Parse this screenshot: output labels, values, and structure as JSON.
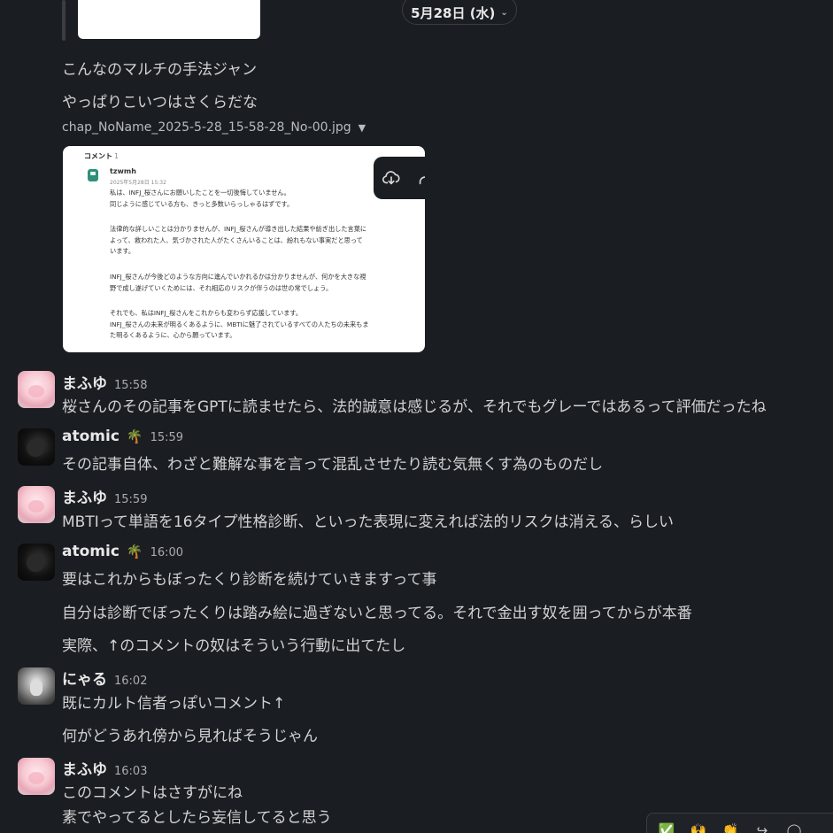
{
  "date_divider": {
    "label": "5月28日 (水)",
    "chevron": "⌄"
  },
  "top_lines": [
    "こんなのマルチの手法ジャン",
    "やっぱりこいつはさくらだな"
  ],
  "attachment": {
    "file_name": "chap_NoName_2025-5-28_15-58-28_No-00.jpg",
    "comment_header": "コメント",
    "comment_count": "1",
    "comment_user": "tzwmh",
    "comment_date": "2025年5月28日 15:32",
    "paragraphs": [
      [
        "私は、INFJ_桜さんにお願いしたことを一切後悔していません。",
        "同じように感じている方も、きっと多数いらっしゃるはずです。"
      ],
      [
        "法律的な詳しいことは分かりませんが、INFJ_桜さんが導き出した結果や紡ぎ出した言葉に",
        "よって、救われた人、気づかされた人がたくさんいることは、紛れもない事実だと思って",
        "います。"
      ],
      [
        "INFJ_桜さんが今後どのような方向に進んでいかれるかは分かりませんが、何かを大きな視",
        "野で成し遂げていくためには、それ相応のリスクが伴うのは世の常でしょう。"
      ],
      [
        "それでも、私はINFJ_桜さんをこれからも変わらず応援しています。",
        "INFJ_桜さんの未来が明るくあるように、MBTIに魅了されているすべての人たちの未来もま",
        "た明るくあるように、心から願っています。"
      ]
    ],
    "toolbar_icons": [
      "download-icon",
      "share-icon",
      "more-vertical-icon"
    ]
  },
  "messages": [
    {
      "name": "まふゆ",
      "emoji": "",
      "time": "15:58",
      "avatar": "mafuyu",
      "lines": [
        "桜さんのその記事をGPTに読ませたら、法的誠意は感じるが、それでもグレーではあるって評価だったね"
      ]
    },
    {
      "name": "atomic",
      "emoji": "🌴",
      "time": "15:59",
      "avatar": "atomic",
      "lines": [
        "その記事自体、わざと難解な事を言って混乱させたり読む気無くす為のものだし"
      ]
    },
    {
      "name": "まふゆ",
      "emoji": "",
      "time": "15:59",
      "avatar": "mafuyu",
      "lines": [
        "MBTIって単語を16タイプ性格診断、といった表現に変えれば法的リスクは消える、らしい"
      ]
    },
    {
      "name": "atomic",
      "emoji": "🌴",
      "time": "16:00",
      "avatar": "atomic",
      "lines": [
        "要はこれからもぼったくり診断を続けていきますって事",
        "自分は診断でぼったくりは踏み絵に過ぎないと思ってる。それで金出す奴を囲ってからが本番",
        "実際、↑のコメントの奴はそういう行動に出てたし"
      ]
    },
    {
      "name": "にゃる",
      "emoji": "",
      "time": "16:02",
      "avatar": "nyaru",
      "lines": [
        "既にカルト信者っぽいコメント↑",
        "何がどうあれ傍から見ればそうじゃん"
      ]
    },
    {
      "name": "まふゆ",
      "emoji": "",
      "time": "16:03",
      "avatar": "mafuyu",
      "lines": [
        "このコメントはさすがにね",
        "素でやってるとしたら妄信してると思う"
      ]
    }
  ],
  "reaction_bar": [
    "✅",
    "🙌",
    "👏",
    "↪",
    "◯"
  ]
}
